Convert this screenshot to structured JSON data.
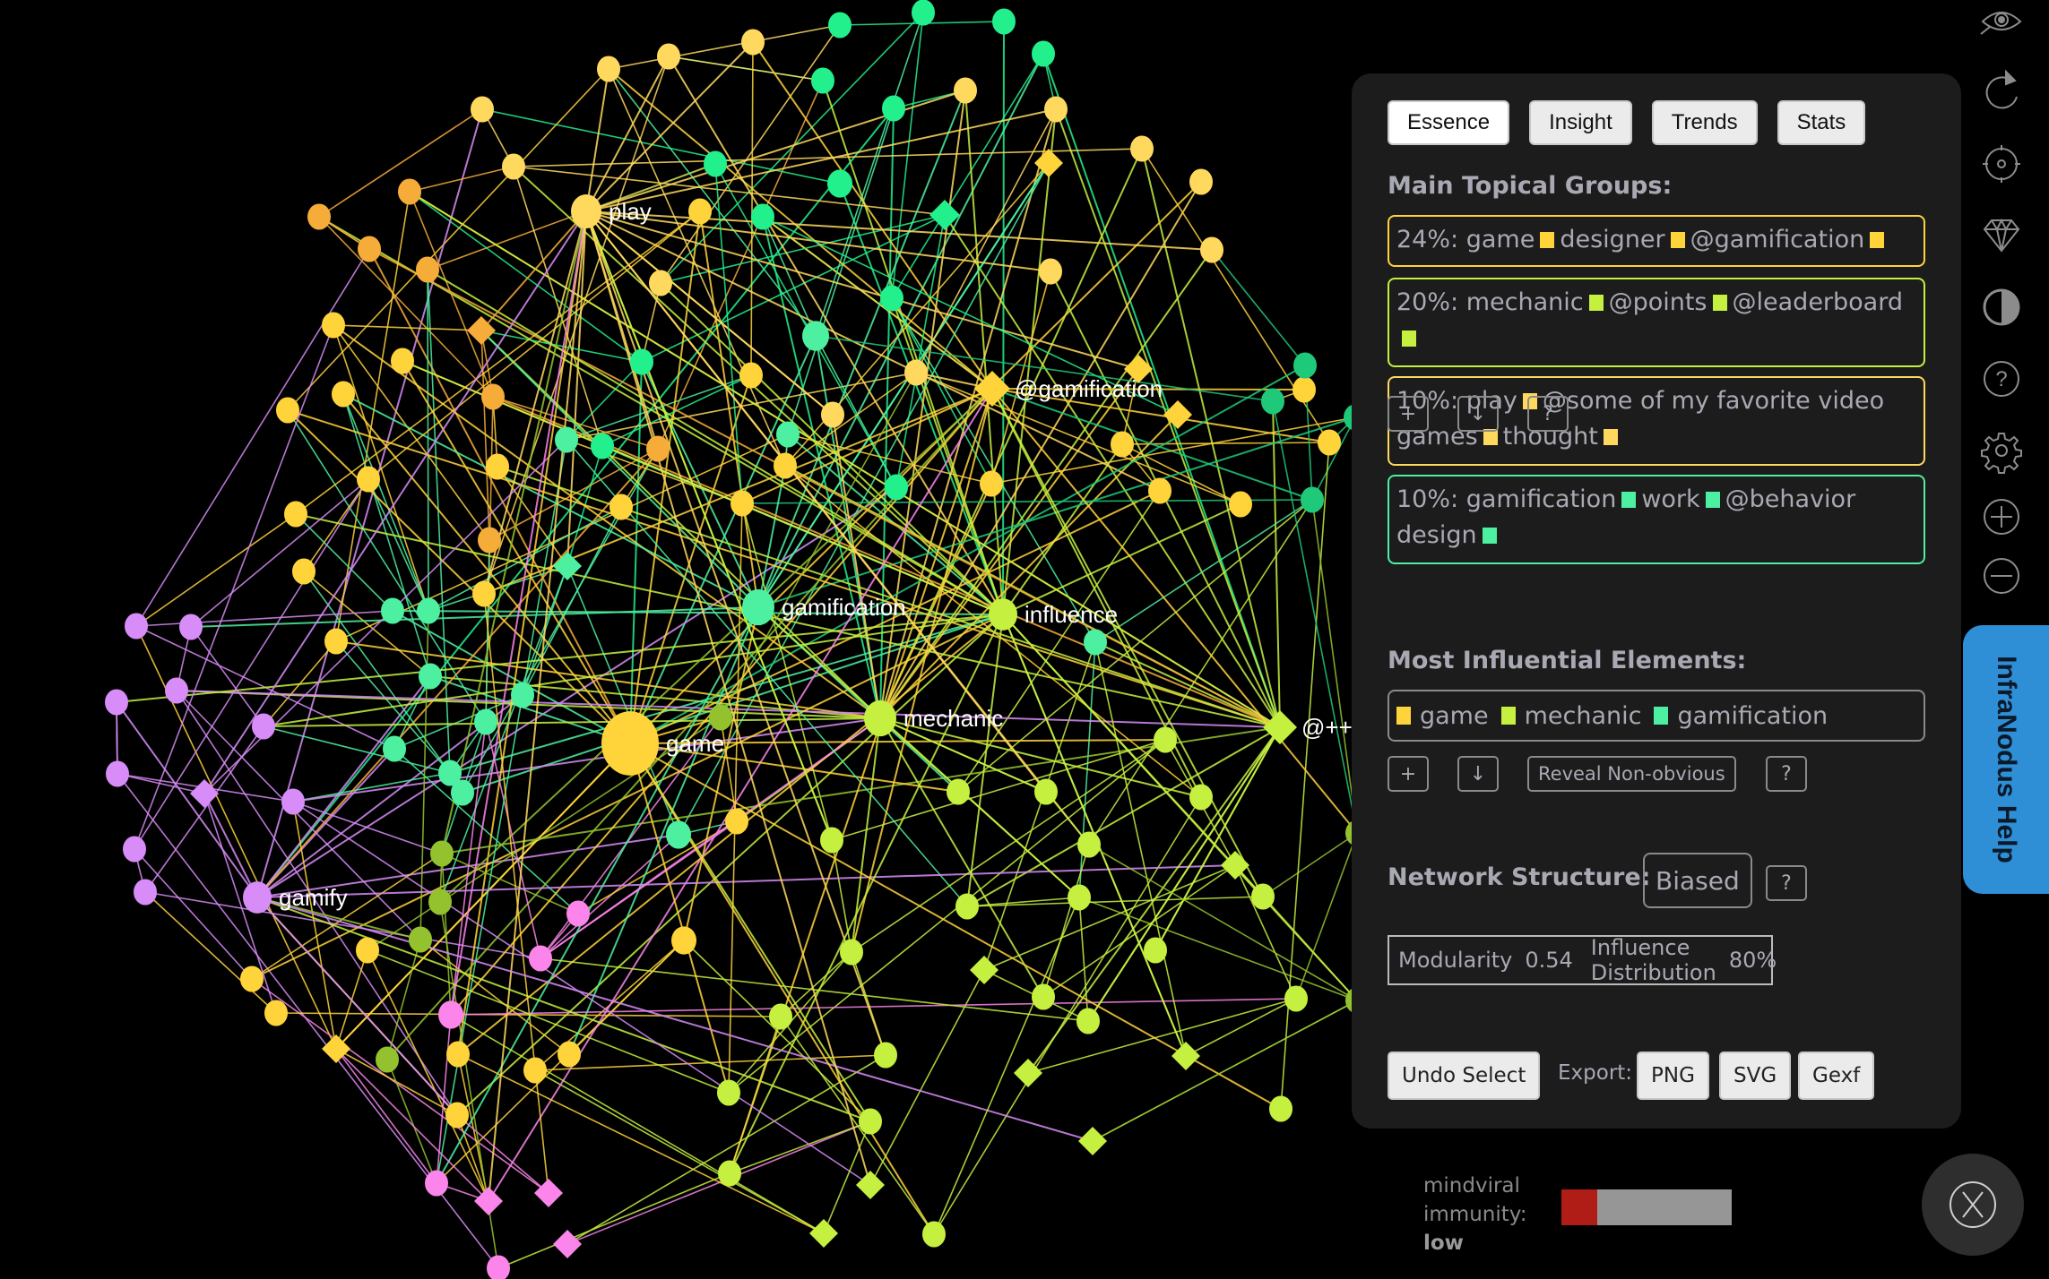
{
  "graph": {
    "group_colors": {
      "game": "#ffd43b",
      "mechanic": "#c5f03f",
      "gamification": "#4cf0a0",
      "gamification_dark": "#22f08c",
      "play": "#ffd95e",
      "orange": "#f5ac38",
      "gamify": "#d78cf7",
      "pink": "#fb85ea",
      "olive": "#94c22e",
      "darkgreen": "#1ec97a"
    },
    "labels": {
      "game": "game",
      "mechanic": "mechanic",
      "gamification": "gamification",
      "influence": "influence",
      "play": "play",
      "at_gamification": "@gamification",
      "gamify": "gamify",
      "at_plusplus": "@++"
    }
  },
  "panel": {
    "tabs": [
      {
        "label": "Essence",
        "active": true
      },
      {
        "label": "Insight",
        "active": false
      },
      {
        "label": "Trends",
        "active": false
      },
      {
        "label": "Stats",
        "active": false
      }
    ],
    "topical_groups_title": "Main Topical Groups:",
    "topical_groups": [
      {
        "percent": "24%:",
        "color": "#ffd43b",
        "terms": [
          "game",
          "designer",
          "@gamification"
        ]
      },
      {
        "percent": "20%:",
        "color": "#c5f03f",
        "terms": [
          "mechanic",
          "@points",
          "@leaderboard"
        ]
      },
      {
        "percent": "10%:",
        "color": "#ffd95e",
        "terms": [
          "play",
          "@some of my favorite video games",
          "thought"
        ]
      },
      {
        "percent": "10%:",
        "color": "#4cf0a0",
        "terms": [
          "gamification",
          "work",
          "@behavior design"
        ]
      }
    ],
    "group_actions": {
      "add": "+",
      "download": "↓",
      "help": "?"
    },
    "influential_title": "Most Influential Elements:",
    "influential": [
      {
        "label": "game",
        "color": "#ffd43b"
      },
      {
        "label": "mechanic",
        "color": "#c5f03f"
      },
      {
        "label": "gamification",
        "color": "#4cf0a0"
      }
    ],
    "influential_actions": {
      "add": "+",
      "download": "↓",
      "reveal": "Reveal Non-obvious",
      "help": "?"
    },
    "structure_title": "Network Structure:",
    "structure_value": "Biased",
    "structure_help": "?",
    "metrics": {
      "modularity_label": "Modularity",
      "modularity_value": "0.54",
      "influence_label": "Influence Distribution",
      "influence_value": "80%"
    },
    "undo_select": "Undo Select",
    "export_label": "Export:",
    "export_buttons": [
      "PNG",
      "SVG",
      "Gexf"
    ]
  },
  "toolbar": {
    "icons": [
      "eye-icon",
      "refresh-icon",
      "target-icon",
      "diamond-icon",
      "contrast-icon",
      "help-icon",
      "gear-icon",
      "zoom-in-icon",
      "zoom-out-icon"
    ]
  },
  "help_tab": "InfraNodus Help",
  "immunity": {
    "line1": "mindviral",
    "line2": "immunity:",
    "level": "low",
    "fraction": 0.21,
    "fill_color": "#b01c16"
  }
}
